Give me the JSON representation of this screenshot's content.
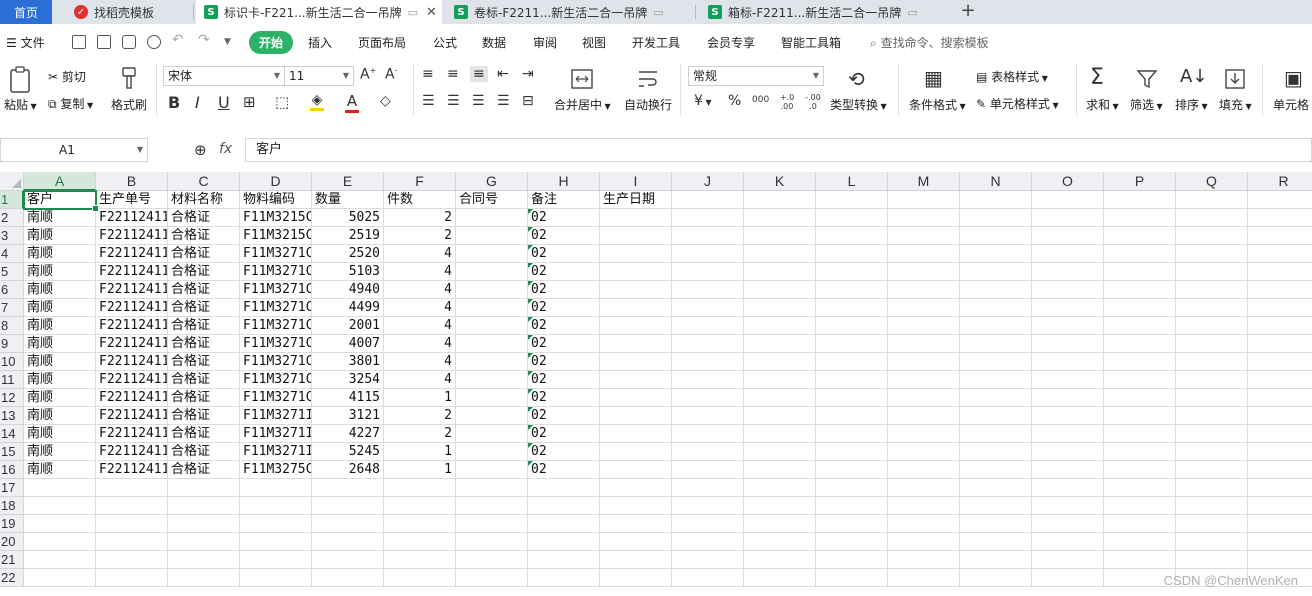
{
  "tabs": [
    {
      "label": "首页",
      "type": "home"
    },
    {
      "label": "找稻壳模板",
      "type": "daoke"
    },
    {
      "label": "标识卡-F221...新生活二合一吊牌",
      "type": "et",
      "active": true
    },
    {
      "label": "卷标-F2211...新生活二合一吊牌",
      "type": "et"
    },
    {
      "label": "箱标-F2211...新生活二合一吊牌",
      "type": "et"
    }
  ],
  "tab_icon_letter": "S",
  "new_tab_symbol": "+",
  "close_symbol": "✕",
  "menu": {
    "file": "文件",
    "items": [
      "开始",
      "插入",
      "页面布局",
      "公式",
      "数据",
      "审阅",
      "视图",
      "开发工具",
      "会员专享",
      "智能工具箱"
    ],
    "active_index": 0,
    "search_placeholder": "查找命令、搜索模板"
  },
  "ribbon": {
    "paste": "粘贴",
    "cut": "剪切",
    "copy": "复制",
    "format_painter": "格式刷",
    "font_name": "宋体",
    "font_size": "11",
    "merge_center": "合并居中",
    "wrap_text": "自动换行",
    "number_format": "常规",
    "type_convert": "类型转换",
    "cond_format": "条件格式",
    "table_style": "表格样式",
    "cell_style": "单元格样式",
    "sum": "求和",
    "filter": "筛选",
    "sort": "排序",
    "fill": "填充",
    "cell": "单元格",
    "bold": "B",
    "italic": "I",
    "underline": "U",
    "currency": "¥",
    "percent": "%",
    "thousands": "000",
    "inc_decimal": "+.0 .00",
    "dec_decimal": "-.00 .0"
  },
  "formula_bar": {
    "cell_ref": "A1",
    "fx_label": "fx",
    "content": "客户"
  },
  "columns": [
    "A",
    "B",
    "C",
    "D",
    "E",
    "F",
    "G",
    "H",
    "I",
    "J",
    "K",
    "L",
    "M",
    "N",
    "O",
    "P",
    "Q",
    "R"
  ],
  "row_numbers": [
    "1",
    "2",
    "3",
    "4",
    "5",
    "6",
    "7",
    "8",
    "9",
    "10",
    "11",
    "12",
    "13",
    "14",
    "15",
    "16",
    "17",
    "18",
    "19",
    "20",
    "21",
    "22"
  ],
  "header_row": [
    "客户",
    "生产单号",
    "材料名称",
    "物料编码",
    "数量",
    "件数",
    "合同号",
    "备注",
    "生产日期"
  ],
  "rows": [
    [
      "南顺",
      "F22112411",
      "合格证",
      "F11M3215C",
      "5025",
      "2",
      "",
      "02"
    ],
    [
      "南顺",
      "F22112411",
      "合格证",
      "F11M3215C",
      "2519",
      "2",
      "",
      "02"
    ],
    [
      "南顺",
      "F22112411",
      "合格证",
      "F11M3271C",
      "2520",
      "4",
      "",
      "02"
    ],
    [
      "南顺",
      "F22112411",
      "合格证",
      "F11M3271C",
      "5103",
      "4",
      "",
      "02"
    ],
    [
      "南顺",
      "F22112411",
      "合格证",
      "F11M3271C",
      "4940",
      "4",
      "",
      "02"
    ],
    [
      "南顺",
      "F22112411",
      "合格证",
      "F11M3271C",
      "4499",
      "4",
      "",
      "02"
    ],
    [
      "南顺",
      "F22112411",
      "合格证",
      "F11M3271C",
      "2001",
      "4",
      "",
      "02"
    ],
    [
      "南顺",
      "F22112411",
      "合格证",
      "F11M3271C",
      "4007",
      "4",
      "",
      "02"
    ],
    [
      "南顺",
      "F22112411",
      "合格证",
      "F11M3271C",
      "3801",
      "4",
      "",
      "02"
    ],
    [
      "南顺",
      "F22112411",
      "合格证",
      "F11M3271C",
      "3254",
      "4",
      "",
      "02"
    ],
    [
      "南顺",
      "F22112411",
      "合格证",
      "F11M3271C",
      "4115",
      "1",
      "",
      "02"
    ],
    [
      "南顺",
      "F22112411",
      "合格证",
      "F11M3271I",
      "3121",
      "2",
      "",
      "02"
    ],
    [
      "南顺",
      "F22112411",
      "合格证",
      "F11M3271I",
      "4227",
      "2",
      "",
      "02"
    ],
    [
      "南顺",
      "F22112411",
      "合格证",
      "F11M3271I",
      "5245",
      "1",
      "",
      "02"
    ],
    [
      "南顺",
      "F22112411",
      "合格证",
      "F11M3275C",
      "2648",
      "1",
      "",
      "02"
    ]
  ],
  "selected_cell": "A1",
  "watermark": "CSDN @ChenWenKen",
  "colors": {
    "accent_green": "#1e8a4e",
    "home_tab_blue": "#2b6fd6",
    "start_button": "#2db169",
    "tab_strip": "#dfe3ea"
  }
}
